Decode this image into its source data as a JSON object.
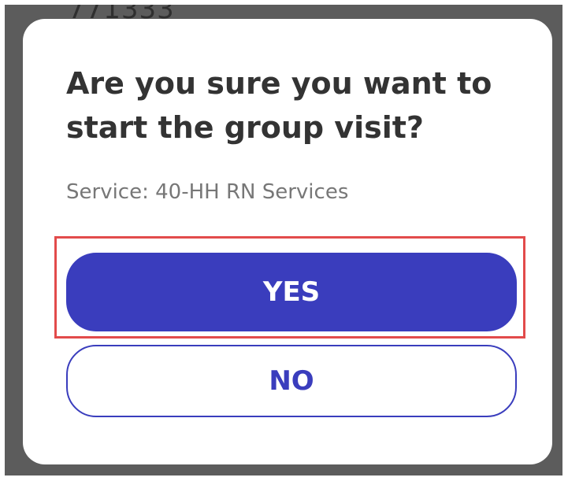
{
  "background": {
    "partial_text": "771333"
  },
  "dialog": {
    "title": "Are you sure you want to start the group visit?",
    "subtitle": "Service: 40-HH RN Services",
    "yes_label": "YES",
    "no_label": "NO"
  },
  "colors": {
    "primary": "#3a3dbd",
    "overlay": "#5c5c5c",
    "highlight": "#e24b4b",
    "title_text": "#333333",
    "subtitle_text": "#777777"
  }
}
